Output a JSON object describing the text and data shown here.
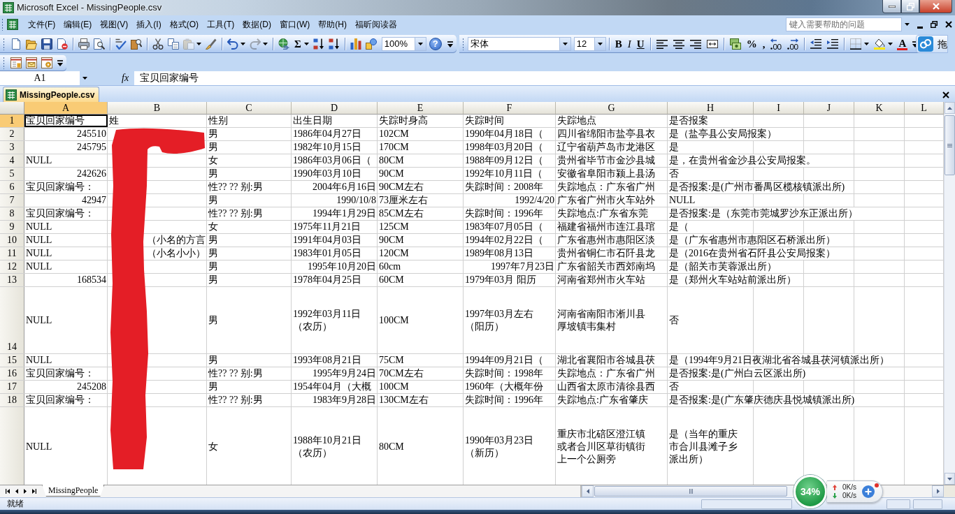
{
  "window": {
    "title": "Microsoft Excel - MissingPeople.csv"
  },
  "menu_bar": {
    "items": [
      "文件(F)",
      "编辑(E)",
      "视图(V)",
      "插入(I)",
      "格式(O)",
      "工具(T)",
      "数据(D)",
      "窗口(W)",
      "帮助(H)",
      "福昕阅读器"
    ],
    "help_search": {
      "placeholder": "键入需要帮助的问题"
    }
  },
  "standard_toolbar": {
    "paste": {
      "disabled": true
    },
    "redo": {
      "disabled": true
    },
    "autosum": "Σ",
    "zoom": "100%",
    "help": "?"
  },
  "formatting_toolbar": {
    "font": "宋体",
    "font_size": "12",
    "bold": "B",
    "italic": "I",
    "underline": "U",
    "percent": "%",
    "comma": ",",
    "font_color": "A"
  },
  "side_button": {
    "label": "拖"
  },
  "formula_bar": {
    "name_box": "A1",
    "function_label": "fx",
    "formula": "宝贝回家编号"
  },
  "workbook": {
    "title": "MissingPeople.csv"
  },
  "sheet": {
    "redacted": true,
    "columns": [
      {
        "label": "A",
        "selected": true
      },
      {
        "label": "B",
        "selected": false
      },
      {
        "label": "C",
        "selected": false
      },
      {
        "label": "D",
        "selected": false
      },
      {
        "label": "E",
        "selected": false
      },
      {
        "label": "F",
        "selected": false
      },
      {
        "label": "G",
        "selected": false
      },
      {
        "label": "H",
        "selected": false
      },
      {
        "label": "I",
        "selected": false
      },
      {
        "label": "J",
        "selected": false
      },
      {
        "label": "K",
        "selected": false
      },
      {
        "label": "L",
        "selected": false
      }
    ],
    "rows": [
      {
        "number": "1",
        "selected": true,
        "cells": {
          "A": {
            "text": "宝贝回家编号",
            "selected": true
          },
          "B": {
            "text": "姓",
            "selected": false
          },
          "C": {
            "text": "性别",
            "selected": false
          },
          "D": {
            "text": "出生日期",
            "selected": false
          },
          "E": {
            "text": "失踪时身高",
            "selected": false
          },
          "F": {
            "text": "失踪时间",
            "selected": false
          },
          "G": {
            "text": "失踪地点",
            "selected": false
          },
          "H": {
            "text": "是否报案",
            "selected": false
          }
        }
      },
      {
        "number": "2",
        "selected": false,
        "cells": {
          "A": {
            "text": "245510",
            "right_aligned": true,
            "selected": false
          },
          "C": {
            "text": "男",
            "selected": false
          },
          "D": {
            "text": "1986年04月27日",
            "selected": false
          },
          "E": {
            "text": "102CM",
            "selected": false
          },
          "F": {
            "text": "1990年04月18日（",
            "selected": false
          },
          "G": {
            "text": "四川省绵阳市盐亭县衣",
            "selected": false
          },
          "H": {
            "text": "是（盐亭县公安局报案）",
            "selected": false
          }
        }
      },
      {
        "number": "3",
        "selected": false,
        "cells": {
          "A": {
            "text": "245795",
            "right_aligned": true,
            "selected": false
          },
          "C": {
            "text": "男",
            "selected": false
          },
          "D": {
            "text": "1982年10月15日",
            "selected": false
          },
          "E": {
            "text": "170CM",
            "selected": false
          },
          "F": {
            "text": "1998年03月20日（",
            "selected": false
          },
          "G": {
            "text": "辽宁省葫芦岛市龙港区",
            "selected": false
          },
          "H": {
            "text": "是",
            "selected": false
          }
        }
      },
      {
        "number": "4",
        "selected": false,
        "cells": {
          "A": {
            "text": "NULL",
            "selected": false
          },
          "C": {
            "text": "女",
            "selected": false
          },
          "D": {
            "text": "1986年03月06日（",
            "selected": false
          },
          "E": {
            "text": "80CM",
            "selected": false
          },
          "F": {
            "text": "1988年09月12日（",
            "selected": false
          },
          "G": {
            "text": "贵州省毕节市金沙县城",
            "selected": false
          },
          "H": {
            "text": "是，在贵州省金沙县公安局报案。",
            "selected": false
          }
        }
      },
      {
        "number": "5",
        "selected": false,
        "cells": {
          "A": {
            "text": "242626",
            "right_aligned": true,
            "selected": false
          },
          "C": {
            "text": "男",
            "selected": false
          },
          "D": {
            "text": "1990年03月10日",
            "selected": false
          },
          "E": {
            "text": "90CM",
            "selected": false
          },
          "F": {
            "text": "1992年10月11日（",
            "selected": false
          },
          "G": {
            "text": "安徽省阜阳市颍上县汤",
            "selected": false
          },
          "H": {
            "text": "否",
            "selected": false
          }
        }
      },
      {
        "number": "6",
        "selected": false,
        "cells": {
          "A": {
            "text": "宝贝回家编号：",
            "selected": false
          },
          "C": {
            "text": "性?? ?? 别:男",
            "selected": false
          },
          "D": {
            "text": "2004年6月16日",
            "right_aligned": true,
            "selected": false
          },
          "E": {
            "text": "90CM左右",
            "selected": false
          },
          "F": {
            "text": "失踪时间：2008年",
            "selected": false
          },
          "G": {
            "text": "失踪地点：广东省广州",
            "selected": false
          },
          "H": {
            "text": "是否报案:是(广州市番禺区榄核镇派出所)",
            "selected": false
          }
        }
      },
      {
        "number": "7",
        "selected": false,
        "cells": {
          "A": {
            "text": "42947",
            "right_aligned": true,
            "selected": false
          },
          "C": {
            "text": "男",
            "selected": false
          },
          "D": {
            "text": "1990/10/8",
            "right_aligned": true,
            "selected": false
          },
          "E": {
            "text": "73厘米左右",
            "selected": false
          },
          "F": {
            "text": "1992/4/20",
            "right_aligned": true,
            "selected": false
          },
          "G": {
            "text": "广东省广州市火车站外",
            "selected": false
          },
          "H": {
            "text": "NULL",
            "selected": false
          }
        }
      },
      {
        "number": "8",
        "selected": false,
        "cells": {
          "A": {
            "text": "宝贝回家编号：",
            "selected": false
          },
          "C": {
            "text": "性?? ?? 别:男",
            "selected": false
          },
          "D": {
            "text": "1994年1月29日",
            "right_aligned": true,
            "selected": false
          },
          "E": {
            "text": "85CM左右",
            "selected": false
          },
          "F": {
            "text": "失踪时间：1996年",
            "selected": false
          },
          "G": {
            "text": "失踪地点:广东省东莞",
            "selected": false
          },
          "H": {
            "text": "是否报案:是（东莞市莞城罗沙东正派出所）",
            "selected": false
          }
        }
      },
      {
        "number": "9",
        "selected": false,
        "cells": {
          "A": {
            "text": "NULL",
            "selected": false
          },
          "C": {
            "text": "女",
            "selected": false
          },
          "D": {
            "text": "1975年11月21日",
            "selected": false
          },
          "E": {
            "text": "125CM",
            "selected": false
          },
          "F": {
            "text": "1983年07月05日（",
            "selected": false
          },
          "G": {
            "text": "福建省福州市连江县琯",
            "selected": false
          },
          "H": {
            "text": "是（",
            "selected": false
          }
        }
      },
      {
        "number": "10",
        "selected": false,
        "cells": {
          "A": {
            "text": "NULL",
            "selected": false
          },
          "B": {
            "text": "（小名的方言",
            "right_aligned": true,
            "selected": false
          },
          "C": {
            "text": "男",
            "selected": false
          },
          "D": {
            "text": "1991年04月03日",
            "selected": false
          },
          "E": {
            "text": "90CM",
            "selected": false
          },
          "F": {
            "text": "1994年02月22日（",
            "selected": false
          },
          "G": {
            "text": "广东省惠州市惠阳区淡",
            "selected": false
          },
          "H": {
            "text": "是（广东省惠州市惠阳区石桥派出所）",
            "selected": false
          }
        }
      },
      {
        "number": "11",
        "selected": false,
        "cells": {
          "A": {
            "text": "NULL",
            "selected": false
          },
          "B": {
            "text": "（小名小小）",
            "right_aligned": true,
            "selected": false
          },
          "C": {
            "text": "男",
            "selected": false
          },
          "D": {
            "text": "1983年01月05日",
            "selected": false
          },
          "E": {
            "text": "120CM",
            "selected": false
          },
          "F": {
            "text": "1989年08月13日",
            "selected": false
          },
          "G": {
            "text": "贵州省铜仁市石阡县龙",
            "selected": false
          },
          "H": {
            "text": "是（2016在贵州省石阡县公安局报案）",
            "selected": false
          }
        }
      },
      {
        "number": "12",
        "selected": false,
        "cells": {
          "A": {
            "text": "NULL",
            "selected": false
          },
          "C": {
            "text": "男",
            "selected": false
          },
          "D": {
            "text": "1995年10月20日",
            "right_aligned": true,
            "selected": false
          },
          "E": {
            "text": "60cm",
            "selected": false
          },
          "F": {
            "text": "1997年7月23日",
            "right_aligned": true,
            "selected": false
          },
          "G": {
            "text": "广东省韶关市西郊南坞",
            "selected": false
          },
          "H": {
            "text": "是（韶关市芙蓉派出所）",
            "selected": false
          }
        }
      },
      {
        "number": "13",
        "selected": false,
        "cells": {
          "A": {
            "text": "168534",
            "right_aligned": true,
            "selected": false
          },
          "C": {
            "text": "男",
            "selected": false
          },
          "D": {
            "text": "1978年04月25日",
            "selected": false
          },
          "E": {
            "text": "60CM",
            "selected": false
          },
          "F": {
            "text": "1979年03月 阳历",
            "selected": false
          },
          "G": {
            "text": "河南省郑州市火车站",
            "selected": false
          },
          "H": {
            "text": "是（郑州火车站站前派出所）",
            "selected": false
          }
        }
      },
      {
        "number": "14",
        "selected": false,
        "cells": {
          "A": {
            "text": "NULL",
            "selected": false
          },
          "C": {
            "text": "男",
            "selected": false
          },
          "D": {
            "text": "1992年03月11日（农历）",
            "wrap": true,
            "selected": false
          },
          "E": {
            "text": "100CM",
            "selected": false
          },
          "F": {
            "text": "1997年03月左右（阳历）",
            "wrap": true,
            "selected": false
          },
          "G": {
            "text": "河南省南阳市淅川县厚坡镇韦集村",
            "wrap": true,
            "selected": false
          },
          "H": {
            "text": "否",
            "selected": false
          }
        }
      },
      {
        "number": "15",
        "selected": false,
        "cells": {
          "A": {
            "text": "NULL",
            "selected": false
          },
          "C": {
            "text": "男",
            "selected": false
          },
          "D": {
            "text": "1993年08月21日",
            "selected": false
          },
          "E": {
            "text": "75CM",
            "selected": false
          },
          "F": {
            "text": "1994年09月21日（",
            "selected": false
          },
          "G": {
            "text": "湖北省襄阳市谷城县茯",
            "selected": false
          },
          "H": {
            "text": "是（1994年9月21日夜湖北省谷城县茯河镇派出所）",
            "selected": false
          }
        }
      },
      {
        "number": "16",
        "selected": false,
        "cells": {
          "A": {
            "text": "宝贝回家编号：",
            "selected": false
          },
          "C": {
            "text": "性?? ?? 别:男",
            "selected": false
          },
          "D": {
            "text": "1995年9月24日",
            "right_aligned": true,
            "selected": false
          },
          "E": {
            "text": "70CM左右",
            "selected": false
          },
          "F": {
            "text": "失踪时间：1998年",
            "selected": false
          },
          "G": {
            "text": "失踪地点：广东省广州",
            "selected": false
          },
          "H": {
            "text": "是否报案:是(广州白云区派出所)",
            "selected": false
          }
        }
      },
      {
        "number": "17",
        "selected": false,
        "cells": {
          "A": {
            "text": "245208",
            "right_aligned": true,
            "selected": false
          },
          "C": {
            "text": "男",
            "selected": false
          },
          "D": {
            "text": "1954年04月（大概",
            "selected": false
          },
          "E": {
            "text": "100CM",
            "selected": false
          },
          "F": {
            "text": "1960年（大概年份",
            "selected": false
          },
          "G": {
            "text": "山西省太原市清徐县西",
            "selected": false
          },
          "H": {
            "text": "否",
            "selected": false
          }
        }
      },
      {
        "number": "18",
        "selected": false,
        "cells": {
          "A": {
            "text": "宝贝回家编号：",
            "selected": false
          },
          "C": {
            "text": "性?? ?? 别:男",
            "selected": false
          },
          "D": {
            "text": "1983年9月28日",
            "right_aligned": true,
            "selected": false
          },
          "E": {
            "text": "130CM左右",
            "selected": false
          },
          "F": {
            "text": "失踪时间：1996年",
            "selected": false
          },
          "G": {
            "text": "失踪地点:广东省肇庆",
            "selected": false
          },
          "H": {
            "text": "是否报案:是(广东肇庆德庆县悦城镇派出所)",
            "selected": false
          }
        }
      },
      {
        "selected": false,
        "cells": {
          "A": {
            "text": "NULL",
            "selected": false
          },
          "C": {
            "text": "女",
            "selected": false
          },
          "D": {
            "text": "1988年10月21日（农历）",
            "wrap": true,
            "selected": false
          },
          "E": {
            "text": "80CM",
            "selected": false
          },
          "F": {
            "text": "1990年03月23日（新历）",
            "wrap": true,
            "selected": false
          },
          "G": {
            "text": "重庆市北碚区澄江镇或者合川区草街镇街上一个公厕旁",
            "wrap": true,
            "selected": false
          },
          "H": {
            "text": "是（当年的重庆市合川县滩子乡派出所）",
            "wrap": true,
            "selected": false
          }
        }
      }
    ]
  },
  "sheet_tabs": [
    {
      "label": "MissingPeople",
      "selected": true
    }
  ],
  "status_bar": {
    "text": "就绪"
  },
  "speed_widget": {
    "usage": "34%",
    "upload": "0K/s",
    "download": "0K/s"
  }
}
